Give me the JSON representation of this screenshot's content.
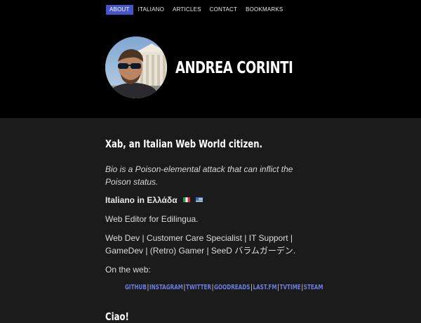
{
  "nav": {
    "items": [
      {
        "label": "ABOUT",
        "active": true
      },
      {
        "label": "ITALIANO",
        "active": false
      },
      {
        "label": "ARTICLES",
        "active": false
      },
      {
        "label": "CONTACT",
        "active": false
      },
      {
        "label": "BOOKMARKS",
        "active": false
      }
    ]
  },
  "header": {
    "title": "ANDREA CORINTI"
  },
  "main": {
    "tagline": "Xab, an Italian Web World citizen.",
    "bio": "Bio is a Poison-elemental attack that can inflict the Poison status.",
    "italiano_label": "Italiano in Ελλάδα",
    "editor": "Web Editor for Edilingua.",
    "roles": "Web Dev | Customer Care Specialist | IT Support | GameDev | (Retro) Gamer | SeeD バラムガーデン.",
    "on_web": "On the web:",
    "links": [
      "GITHUB",
      "INSTAGRAM",
      "TWITTER",
      "GOODREADS",
      "LAST.FM",
      "TVTIME",
      "STEAM"
    ],
    "ciao": "Ciao!"
  },
  "colors": {
    "header_bg": "#000000",
    "body_bg": "#1b1b1b",
    "accent": "#4455cc",
    "link": "#6a7de0"
  },
  "icons": [
    "avatar-photo",
    "flag-italy-icon",
    "flag-greece-icon"
  ]
}
